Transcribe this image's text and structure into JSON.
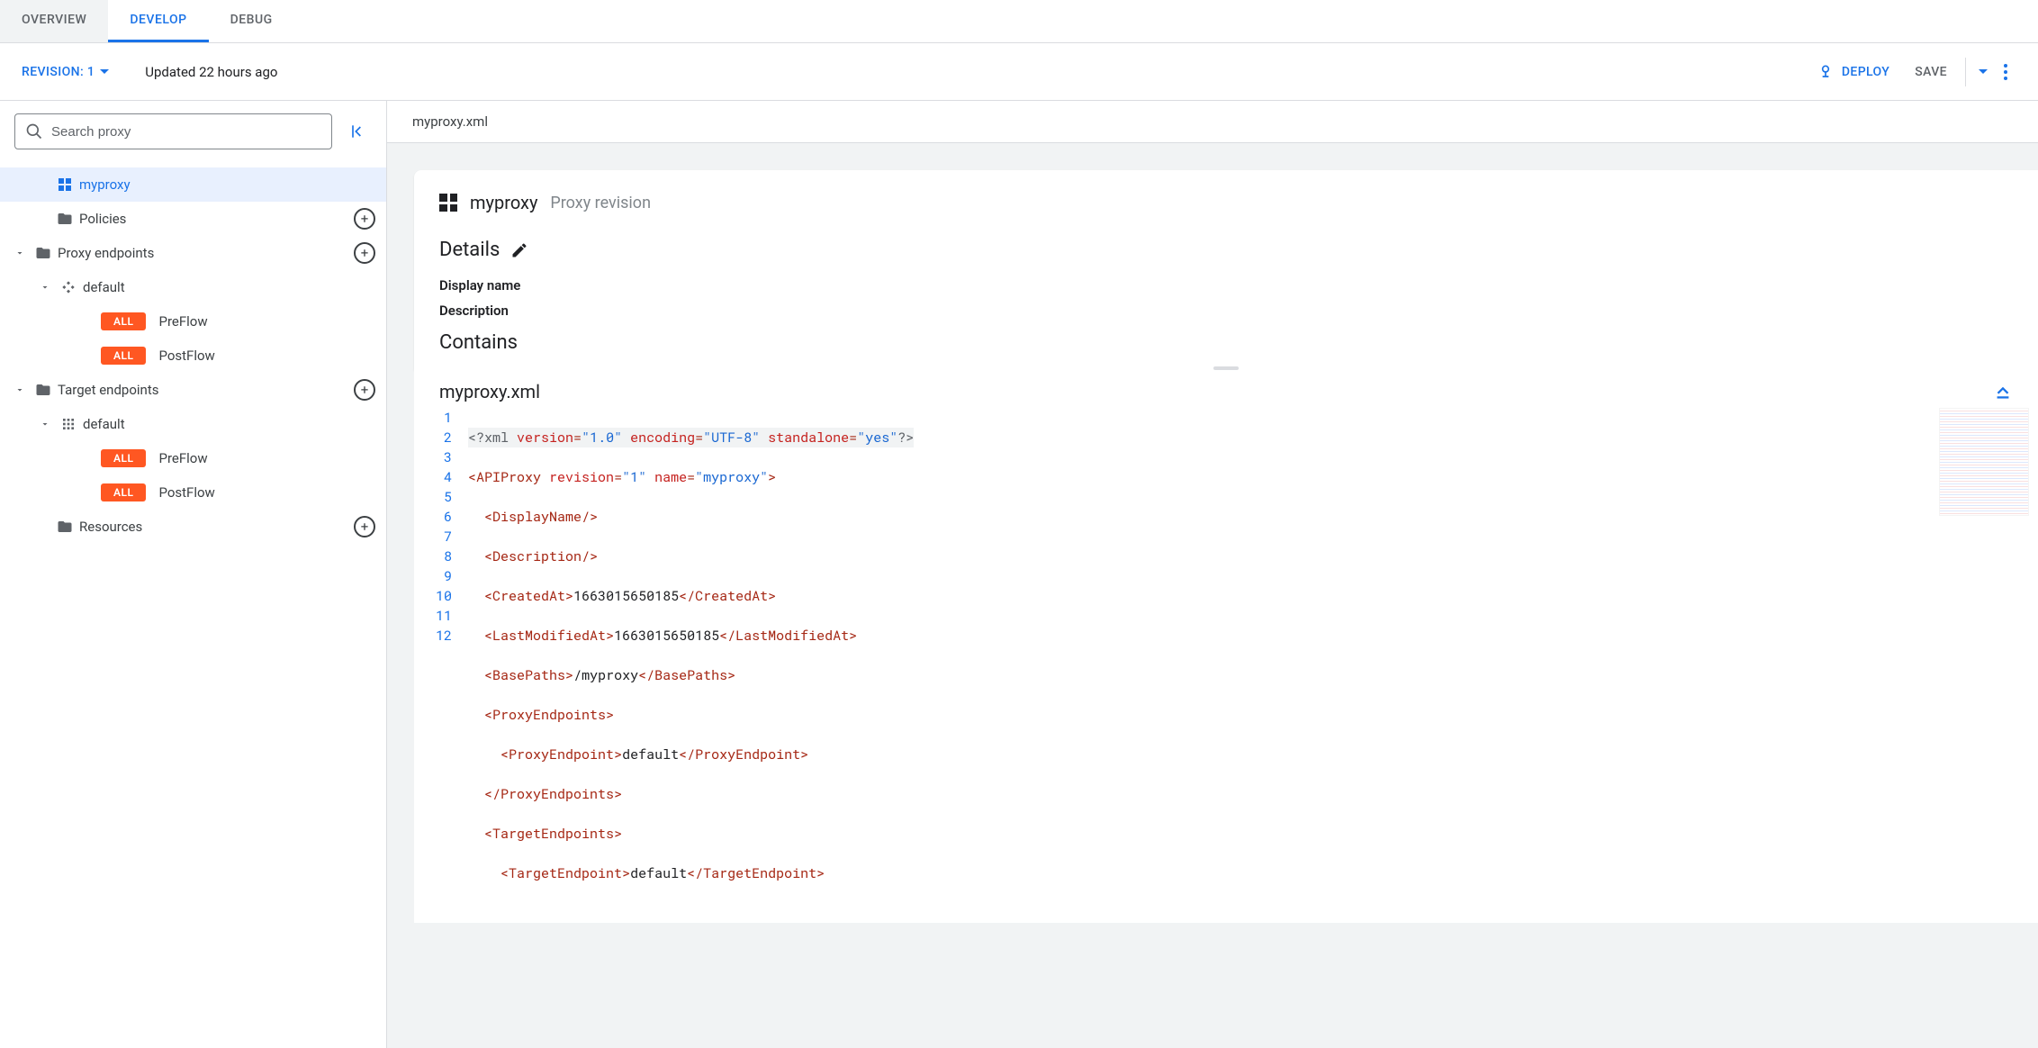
{
  "tabs": {
    "overview": "OVERVIEW",
    "develop": "DEVELOP",
    "debug": "DEBUG"
  },
  "revbar": {
    "revision": "REVISION: 1",
    "updated": "Updated 22 hours ago",
    "deploy": "DEPLOY",
    "save": "SAVE"
  },
  "sidebar": {
    "searchPlaceholder": "Search proxy",
    "tree": {
      "myproxy": "myproxy",
      "policies": "Policies",
      "proxyEndpoints": "Proxy endpoints",
      "peDefault": "default",
      "pePreflowBadge": "ALL",
      "pePreflow": "PreFlow",
      "pePostflowBadge": "ALL",
      "pePostflow": "PostFlow",
      "targetEndpoints": "Target endpoints",
      "teDefault": "default",
      "tePreflowBadge": "ALL",
      "tePreflow": "PreFlow",
      "tePostflowBadge": "ALL",
      "tePostflow": "PostFlow",
      "resources": "Resources"
    }
  },
  "content": {
    "breadcrumbFile": "myproxy.xml",
    "title": "myproxy",
    "subtitle": "Proxy revision",
    "detailsHeading": "Details",
    "displayNameLabel": "Display name",
    "descriptionLabel": "Description",
    "containsHeading": "Contains",
    "codeFilename": "myproxy.xml"
  },
  "code": {
    "lines": [
      "1",
      "2",
      "3",
      "4",
      "5",
      "6",
      "7",
      "8",
      "9",
      "10",
      "11",
      "12"
    ],
    "xmlDecl": {
      "open": "<?xml",
      "version": "version",
      "versionVal": "\"1.0\"",
      "encoding": "encoding",
      "encodingVal": "\"UTF-8\"",
      "standalone": "standalone",
      "standaloneVal": "\"yes\"",
      "close": "?>"
    },
    "apiproxy": {
      "tag": "APIProxy",
      "revision": "revision",
      "revisionVal": "\"1\"",
      "name": "name",
      "nameVal": "\"myproxy\""
    },
    "displayName": "DisplayName",
    "description": "Description",
    "createdAt": {
      "tag": "CreatedAt",
      "val": "1663015650185"
    },
    "lastModifiedAt": {
      "tag": "LastModifiedAt",
      "val": "1663015650185"
    },
    "basePaths": {
      "tag": "BasePaths",
      "val": "/myproxy"
    },
    "proxyEndpoints": "ProxyEndpoints",
    "proxyEndpoint": {
      "tag": "ProxyEndpoint",
      "val": "default"
    },
    "targetEndpoints": "TargetEndpoints",
    "targetEndpoint": {
      "tag": "TargetEndpoint",
      "val": "default"
    }
  }
}
